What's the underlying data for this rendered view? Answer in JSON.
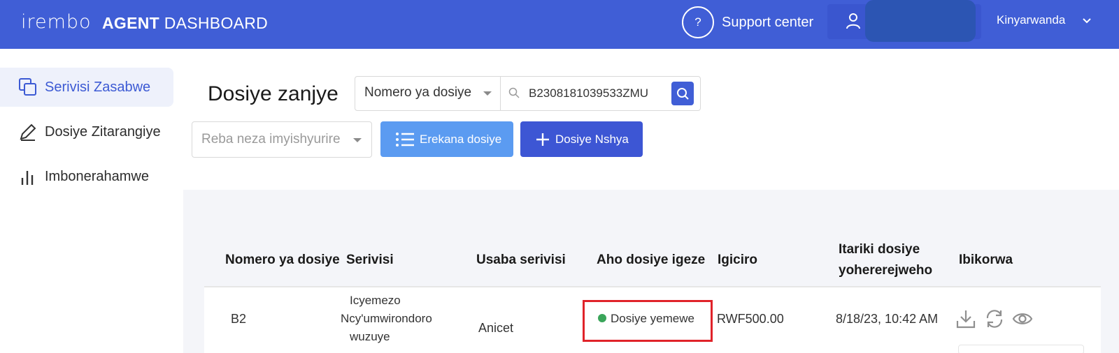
{
  "header": {
    "logo_text": "irembo",
    "title_bold": "AGENT",
    "title_regular": "DASHBOARD",
    "help_label": "?",
    "support_label": "Support center",
    "language": "Kinyarwanda"
  },
  "sidebar": {
    "items": [
      {
        "label": "Serivisi Zasabwe",
        "icon": "copy-icon",
        "active": true
      },
      {
        "label": "Dosiye Zitarangiye",
        "icon": "pen-icon",
        "active": false
      },
      {
        "label": "Imbonerahamwe",
        "icon": "bar-chart-icon",
        "active": false
      }
    ]
  },
  "main": {
    "page_title": "Dosiye zanjye",
    "search": {
      "type_selected": "Nomero ya dosiye",
      "value": "B2308181039533ZMU"
    },
    "filter_placeholder": "Reba neza imyishyurire",
    "list_button": "Erekana dosiye",
    "new_button": "Dosiye Nshya"
  },
  "table": {
    "headers": {
      "number": "Nomero ya dosiye",
      "service": "Serivisi",
      "applicant": "Usaba serivisi",
      "status": "Aho dosiye igeze",
      "price": "Igiciro",
      "date_line1": "Itariki dosiye",
      "date_line2": "yohererejweho",
      "actions": "Ibikorwa"
    },
    "rows": [
      {
        "number": "B2",
        "service_line1": "Icyemezo",
        "service_line2": "Ncy'umwirondoro",
        "service_line3": "wuzuye",
        "applicant": "Anicet",
        "status": "Dosiye yemewe",
        "price": "RWF500.00",
        "date": "8/18/23, 10:42 AM"
      }
    ]
  },
  "colors": {
    "brand": "#405ed6",
    "list_button": "#5b9bf1",
    "status_green": "#3aa55a",
    "highlight_red": "#e0232a"
  }
}
